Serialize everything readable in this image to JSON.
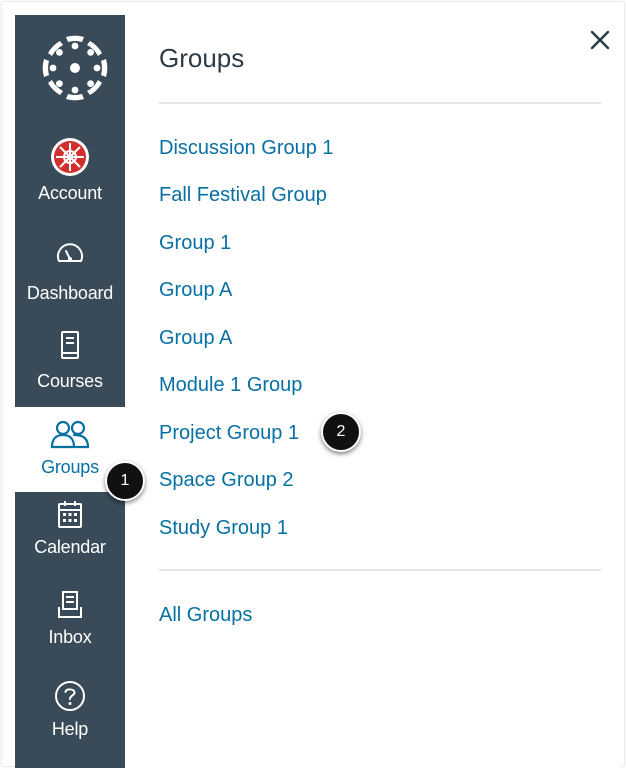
{
  "colors": {
    "sidebar_bg": "#394B58",
    "link": "#0770A3",
    "active_bg": "#FFFFFF",
    "title": "#2D3B45",
    "callout_bg": "#111111"
  },
  "sidebar": {
    "logo_icon": "canvas-logo-icon",
    "items": [
      {
        "label": "Account",
        "icon": "account-avatar-icon"
      },
      {
        "label": "Dashboard",
        "icon": "dashboard-gauge-icon"
      },
      {
        "label": "Courses",
        "icon": "courses-book-icon"
      },
      {
        "label": "Groups",
        "icon": "groups-icon",
        "active": true
      },
      {
        "label": "Calendar",
        "icon": "calendar-icon"
      },
      {
        "label": "Inbox",
        "icon": "inbox-icon"
      },
      {
        "label": "Help",
        "icon": "help-icon"
      }
    ]
  },
  "panel": {
    "title": "Groups",
    "close_label": "✕",
    "groups": [
      "Discussion Group 1",
      "Fall Festival Group",
      "Group 1",
      "Group A",
      "Group A",
      "Module 1 Group",
      "Project Group 1",
      "Space Group 2",
      "Study Group 1"
    ],
    "all_groups_label": "All Groups"
  },
  "callouts": [
    {
      "number": "1"
    },
    {
      "number": "2"
    }
  ]
}
